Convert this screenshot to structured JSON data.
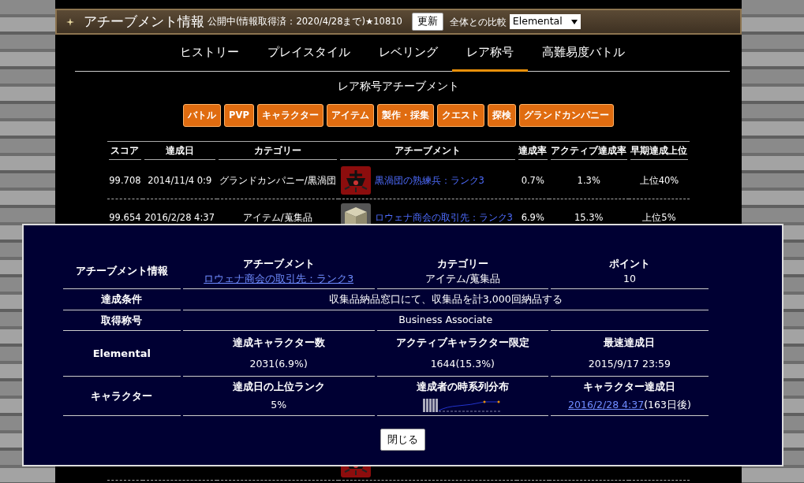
{
  "header": {
    "title": "アチーブメント情報",
    "status": "公開中(情報取得済：2020/4/28まで)★10810",
    "refresh_button": "更新",
    "compare_label": "全体との比較",
    "compare_select": "Elemental"
  },
  "tabs": [
    {
      "label": "ヒストリー",
      "selected": false
    },
    {
      "label": "プレイスタイル",
      "selected": false
    },
    {
      "label": "レベリング",
      "selected": false
    },
    {
      "label": "レア称号",
      "selected": true
    },
    {
      "label": "高難易度バトル",
      "selected": false
    }
  ],
  "section_title": "レア称号アチーブメント",
  "category_buttons": [
    "バトル",
    "PVP",
    "キャラクター",
    "アイテム",
    "製作・採集",
    "クエスト",
    "探検",
    "グランドカンパニー"
  ],
  "table": {
    "columns": [
      "スコア",
      "達成日",
      "カテゴリー",
      "アチーブメント",
      "達成率",
      "アクティブ達成率",
      "早期達成上位"
    ],
    "rows": [
      {
        "score": "99.708",
        "date": "2014/11/4 0:9",
        "category": "グランドカンパニー/黒渦団",
        "kind": "emblem",
        "achievement": "黒渦団の熟練兵：ランク3",
        "rate": "0.7%",
        "active_rate": "1.3%",
        "early_rank": "上位40%"
      },
      {
        "score": "99.654",
        "date": "2016/2/28 4:37",
        "category": "アイテム/蒐集品",
        "kind": "crate",
        "achievement": "ロウェナ商会の取引先：ランク3",
        "rate": "6.9%",
        "active_rate": "15.3%",
        "early_rank": "上位5%"
      },
      {
        "kind": "emblem"
      }
    ]
  },
  "modal": {
    "info_label": "アチーブメント情報",
    "info_columns": [
      {
        "heading": "アチーブメント",
        "value": "ロウェナ商会の取引先：ランク3",
        "kind": "link"
      },
      {
        "heading": "カテゴリー",
        "value": "アイテム/蒐集品",
        "kind": "text"
      },
      {
        "heading": "ポイント",
        "value": "10",
        "kind": "text"
      }
    ],
    "condition_label": "達成条件",
    "condition": "収集品納品窓口にて、収集品を計3,000回納品する",
    "title_label": "取得称号",
    "title_value": "Business Associate",
    "world_label": "Elemental",
    "world_columns": [
      {
        "heading": "達成キャラクター数",
        "value": "2031(6.9%)"
      },
      {
        "heading": "アクティブキャラクター限定",
        "value": "1644(15.3%)"
      },
      {
        "heading": "最速達成日",
        "value": "2015/9/17 23:59"
      }
    ],
    "character_label": "キャラクター",
    "rank_heading": "達成日の上位ランク",
    "rank_value": "5%",
    "distribution_heading": "達成者の時系列分布",
    "date_heading": "キャラクター達成日",
    "date_link": "2016/2/28 4:37",
    "date_note": "(163日後)",
    "close_button": "閉じる"
  }
}
